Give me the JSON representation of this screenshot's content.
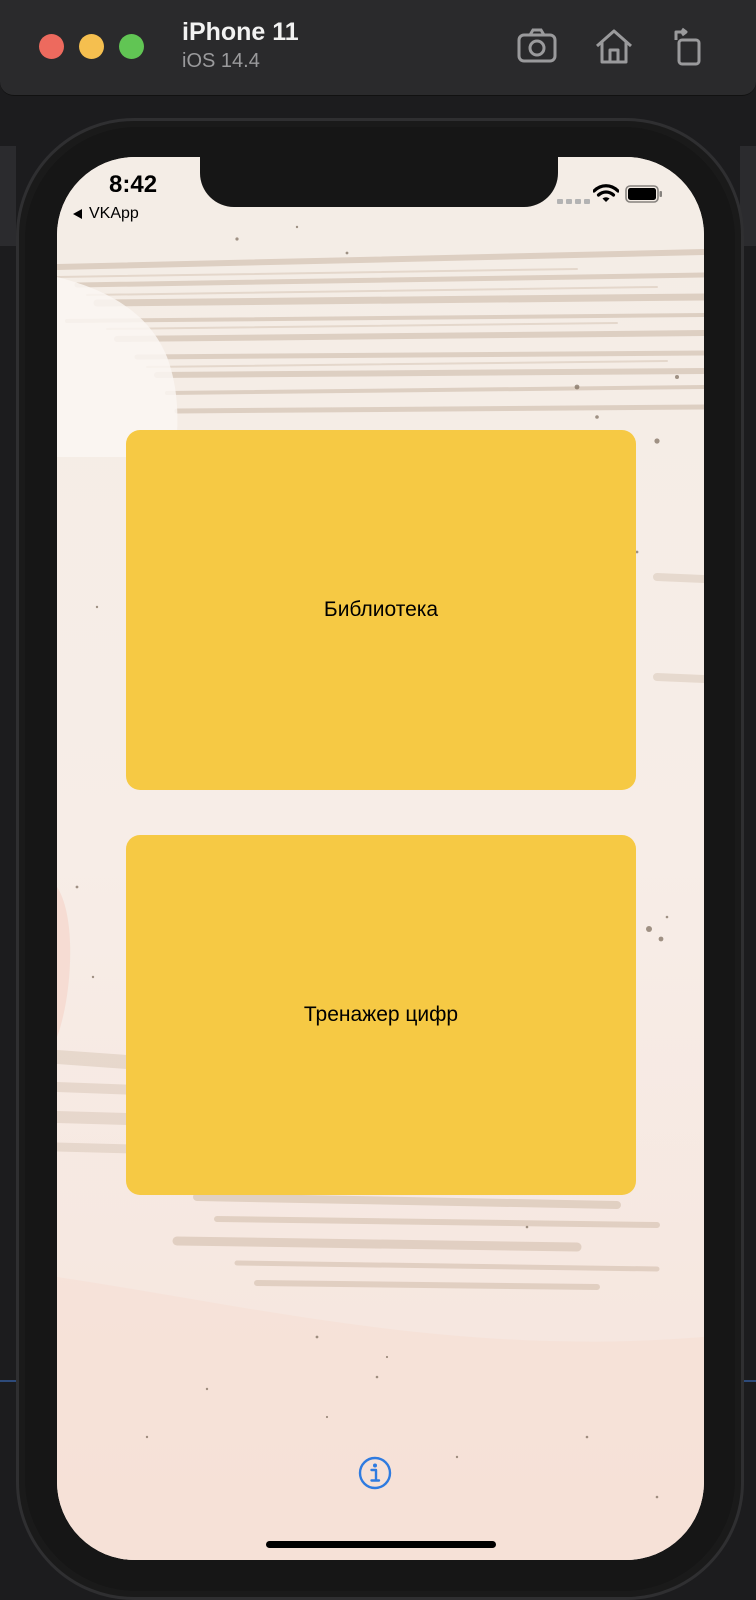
{
  "simulator": {
    "device_name": "iPhone 11",
    "os_version": "iOS 14.4",
    "toolbar_icons": [
      "screenshot-icon",
      "home-icon",
      "rotate-icon"
    ]
  },
  "status_bar": {
    "time": "8:42",
    "back_app": "VKApp",
    "icons": [
      "signal-icon",
      "wifi-icon",
      "battery-icon"
    ]
  },
  "main": {
    "buttons": [
      {
        "label": "Библиотека"
      },
      {
        "label": "Тренажер цифр"
      }
    ],
    "info_icon": "info-icon"
  },
  "colors": {
    "button_fill": "#f6c944",
    "info_accent": "#2f7be0",
    "background": "#f6ece5"
  }
}
